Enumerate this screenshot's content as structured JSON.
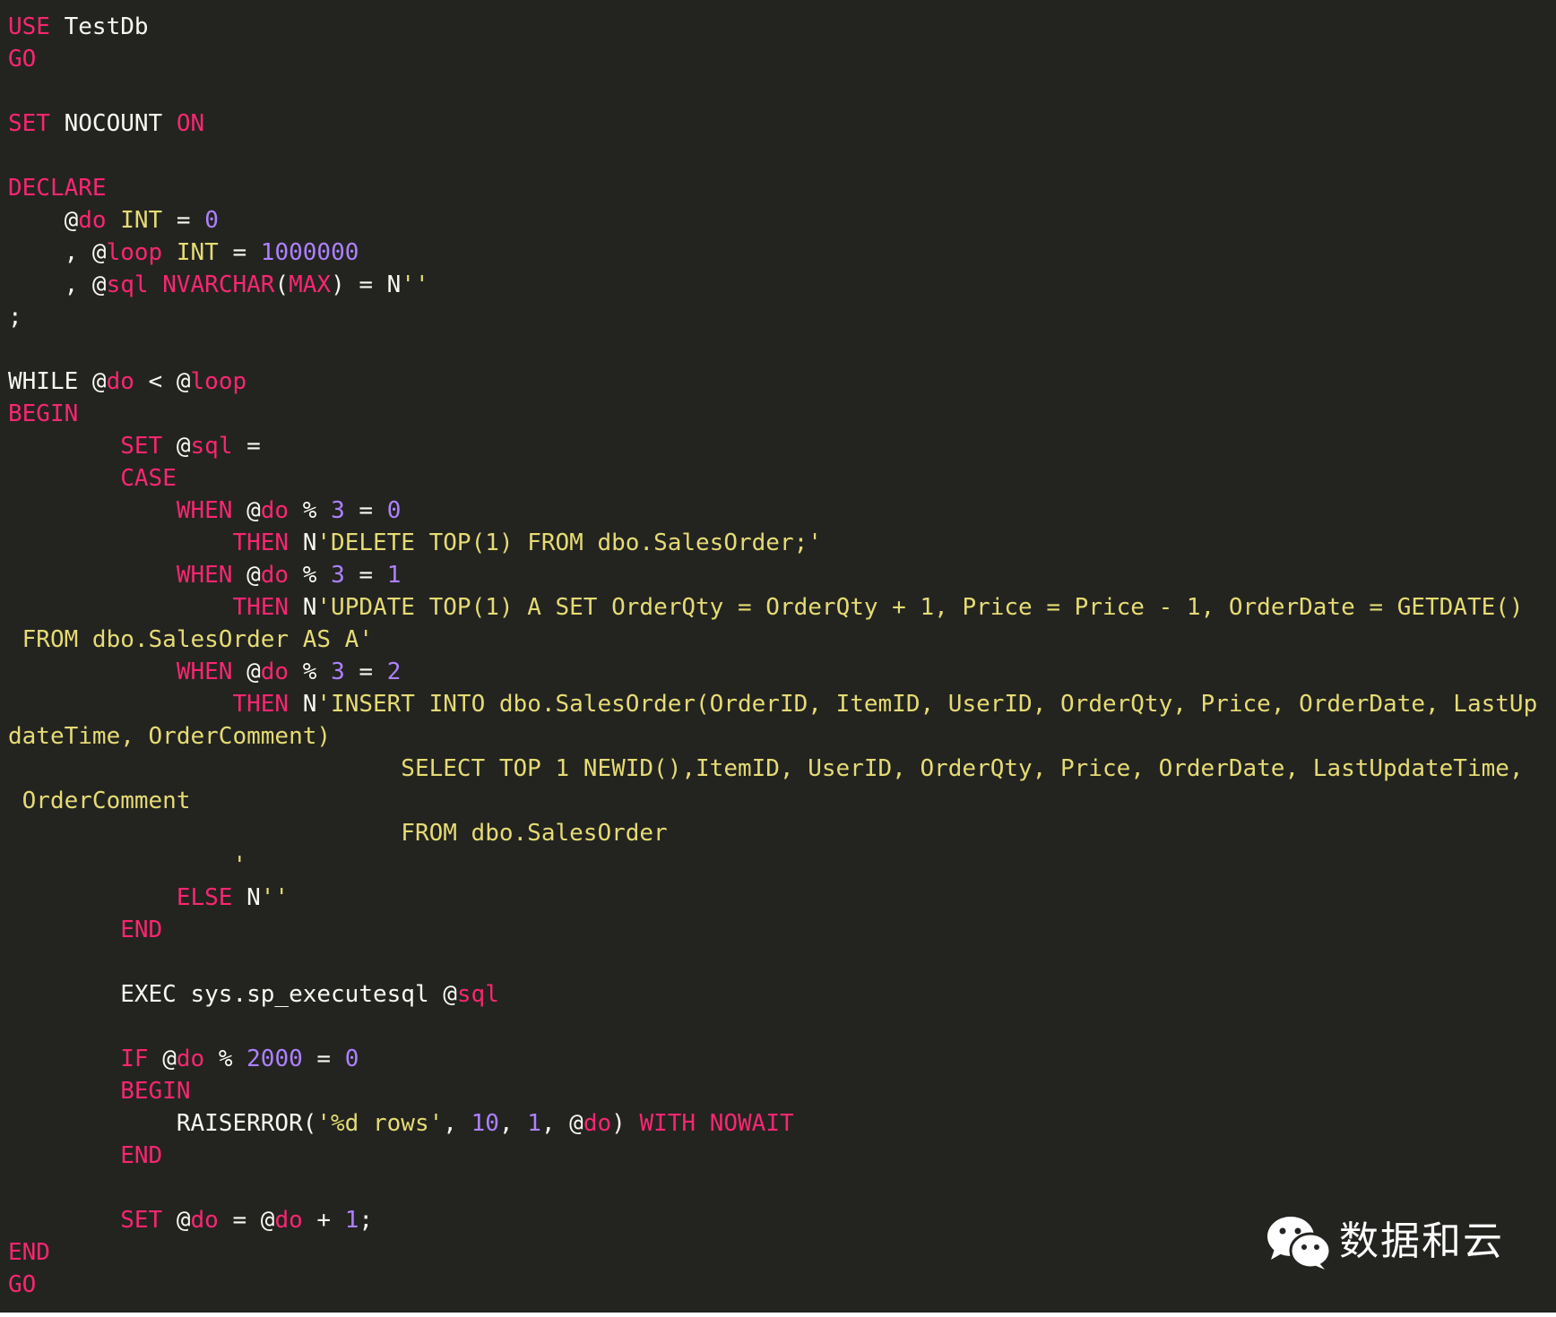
{
  "editor": {
    "language": "T-SQL",
    "colors": {
      "background": "#232420",
      "keyword": "#f92672",
      "plain": "#f8f8f2",
      "number": "#ae81ff",
      "type": "#e6db74",
      "string": "#e6db74"
    },
    "lines": [
      [
        [
          "kw",
          "USE"
        ],
        [
          "plain",
          " TestDb"
        ]
      ],
      [
        [
          "kw",
          "GO"
        ]
      ],
      [],
      [
        [
          "kw",
          "SET"
        ],
        [
          "plain",
          " NOCOUNT "
        ],
        [
          "kw",
          "ON"
        ]
      ],
      [],
      [
        [
          "kw",
          "DECLARE"
        ]
      ],
      [
        [
          "plain",
          "    @"
        ],
        [
          "var",
          "do"
        ],
        [
          "plain",
          " "
        ],
        [
          "type",
          "INT"
        ],
        [
          "plain",
          " = "
        ],
        [
          "num",
          "0"
        ]
      ],
      [
        [
          "plain",
          "    , @"
        ],
        [
          "var",
          "loop"
        ],
        [
          "plain",
          " "
        ],
        [
          "type",
          "INT"
        ],
        [
          "plain",
          " = "
        ],
        [
          "num",
          "1000000"
        ]
      ],
      [
        [
          "plain",
          "    , @"
        ],
        [
          "var",
          "sql"
        ],
        [
          "plain",
          " "
        ],
        [
          "kw",
          "NVARCHAR"
        ],
        [
          "plain",
          "("
        ],
        [
          "kw",
          "MAX"
        ],
        [
          "plain",
          ") = N"
        ],
        [
          "str",
          "''"
        ]
      ],
      [
        [
          "plain",
          ";"
        ]
      ],
      [],
      [
        [
          "plain",
          "WHILE @"
        ],
        [
          "var",
          "do"
        ],
        [
          "plain",
          " < @"
        ],
        [
          "var",
          "loop"
        ]
      ],
      [
        [
          "kw",
          "BEGIN"
        ]
      ],
      [
        [
          "plain",
          "        "
        ],
        [
          "kw",
          "SET"
        ],
        [
          "plain",
          " @"
        ],
        [
          "var",
          "sql"
        ],
        [
          "plain",
          " ="
        ]
      ],
      [
        [
          "plain",
          "        "
        ],
        [
          "kw",
          "CASE"
        ]
      ],
      [
        [
          "plain",
          "            "
        ],
        [
          "kw",
          "WHEN"
        ],
        [
          "plain",
          " @"
        ],
        [
          "var",
          "do"
        ],
        [
          "plain",
          " % "
        ],
        [
          "num",
          "3"
        ],
        [
          "plain",
          " = "
        ],
        [
          "num",
          "0"
        ]
      ],
      [
        [
          "plain",
          "                "
        ],
        [
          "kw",
          "THEN"
        ],
        [
          "plain",
          " N"
        ],
        [
          "str",
          "'DELETE TOP(1) FROM dbo.SalesOrder;'"
        ]
      ],
      [
        [
          "plain",
          "            "
        ],
        [
          "kw",
          "WHEN"
        ],
        [
          "plain",
          " @"
        ],
        [
          "var",
          "do"
        ],
        [
          "plain",
          " % "
        ],
        [
          "num",
          "3"
        ],
        [
          "plain",
          " = "
        ],
        [
          "num",
          "1"
        ]
      ],
      [
        [
          "plain",
          "                "
        ],
        [
          "kw",
          "THEN"
        ],
        [
          "plain",
          " N"
        ],
        [
          "str",
          "'UPDATE TOP(1) A SET OrderQty = OrderQty + 1, Price = Price - 1, OrderDate = GETDATE()"
        ]
      ],
      [
        [
          "str",
          " FROM dbo.SalesOrder AS A'"
        ]
      ],
      [
        [
          "plain",
          "            "
        ],
        [
          "kw",
          "WHEN"
        ],
        [
          "plain",
          " @"
        ],
        [
          "var",
          "do"
        ],
        [
          "plain",
          " % "
        ],
        [
          "num",
          "3"
        ],
        [
          "plain",
          " = "
        ],
        [
          "num",
          "2"
        ]
      ],
      [
        [
          "plain",
          "                "
        ],
        [
          "kw",
          "THEN"
        ],
        [
          "plain",
          " N"
        ],
        [
          "str",
          "'INSERT INTO dbo.SalesOrder(OrderID, ItemID, UserID, OrderQty, Price, OrderDate, LastUp"
        ]
      ],
      [
        [
          "str",
          "dateTime, OrderComment)"
        ]
      ],
      [
        [
          "str",
          "                            SELECT TOP 1 NEWID(),ItemID, UserID, OrderQty, Price, OrderDate, LastUpdateTime,"
        ]
      ],
      [
        [
          "str",
          " OrderComment"
        ]
      ],
      [
        [
          "str",
          "                            FROM dbo.SalesOrder"
        ]
      ],
      [
        [
          "str",
          "                '"
        ]
      ],
      [
        [
          "plain",
          "            "
        ],
        [
          "kw",
          "ELSE"
        ],
        [
          "plain",
          " N"
        ],
        [
          "str",
          "''"
        ]
      ],
      [
        [
          "plain",
          "        "
        ],
        [
          "kw",
          "END"
        ]
      ],
      [],
      [
        [
          "plain",
          "        EXEC sys.sp_executesql @"
        ],
        [
          "var",
          "sql"
        ]
      ],
      [],
      [
        [
          "plain",
          "        "
        ],
        [
          "kw",
          "IF"
        ],
        [
          "plain",
          " @"
        ],
        [
          "var",
          "do"
        ],
        [
          "plain",
          " % "
        ],
        [
          "num",
          "2000"
        ],
        [
          "plain",
          " = "
        ],
        [
          "num",
          "0"
        ]
      ],
      [
        [
          "plain",
          "        "
        ],
        [
          "kw",
          "BEGIN"
        ]
      ],
      [
        [
          "plain",
          "            RAISERROR("
        ],
        [
          "str",
          "'%d rows'"
        ],
        [
          "plain",
          ", "
        ],
        [
          "num",
          "10"
        ],
        [
          "plain",
          ", "
        ],
        [
          "num",
          "1"
        ],
        [
          "plain",
          ", @"
        ],
        [
          "var",
          "do"
        ],
        [
          "plain",
          ") "
        ],
        [
          "kw",
          "WITH NOWAIT"
        ]
      ],
      [
        [
          "plain",
          "        "
        ],
        [
          "kw",
          "END"
        ]
      ],
      [],
      [
        [
          "plain",
          "        "
        ],
        [
          "kw",
          "SET"
        ],
        [
          "plain",
          " @"
        ],
        [
          "var",
          "do"
        ],
        [
          "plain",
          " = @"
        ],
        [
          "var",
          "do"
        ],
        [
          "plain",
          " + "
        ],
        [
          "num",
          "1"
        ],
        [
          "plain",
          ";"
        ]
      ],
      [
        [
          "kw",
          "END"
        ]
      ],
      [
        [
          "kw",
          "GO"
        ]
      ]
    ]
  },
  "watermark": {
    "icon": "wechat-icon",
    "text": "数据和云"
  }
}
